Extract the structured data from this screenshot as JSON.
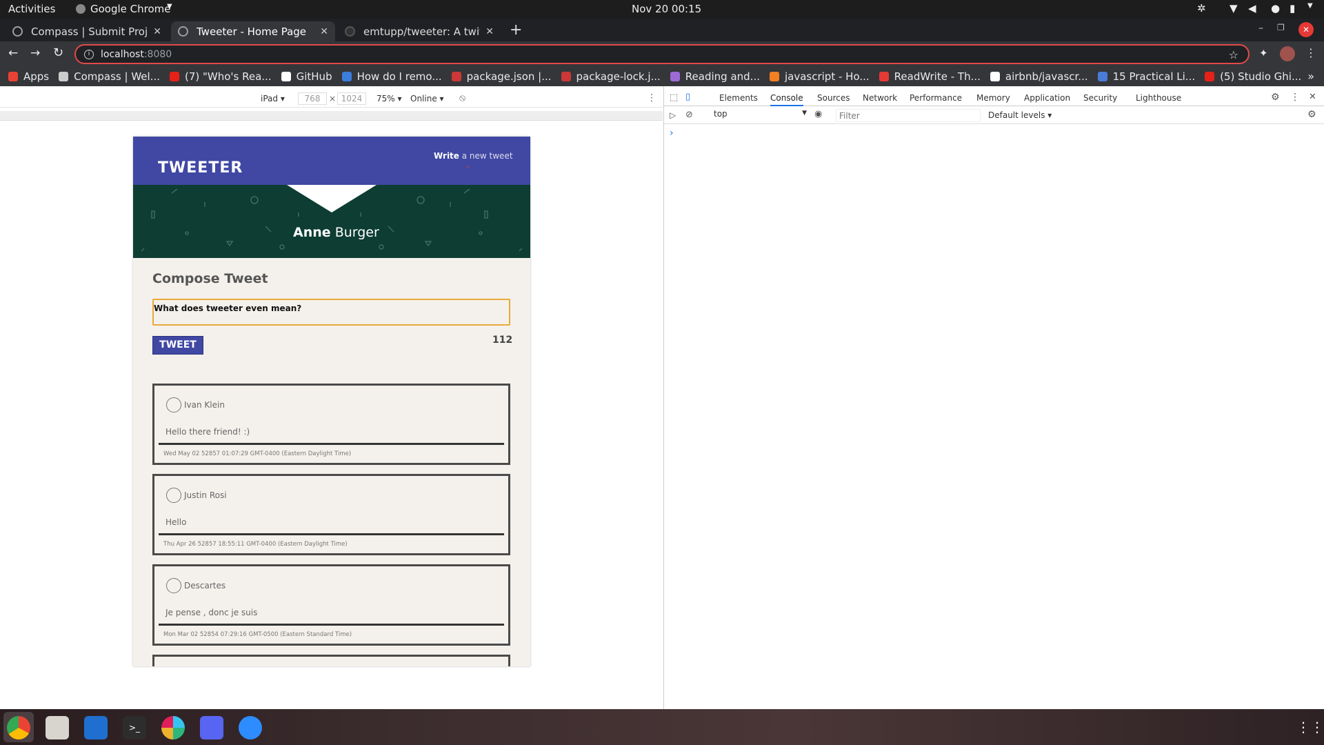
{
  "topbar": {
    "activities": "Activities",
    "app_name": "Google Chrome",
    "datetime": "Nov 20  00:15"
  },
  "tabs": [
    {
      "title": "Compass | Submit Project"
    },
    {
      "title": "Tweeter - Home Page"
    },
    {
      "title": "emtupp/tweeter: A twitter"
    }
  ],
  "omnibox": {
    "host": "localhost",
    "port": ":8080"
  },
  "bookmarks": [
    {
      "label": "Apps",
      "color": "#e94235"
    },
    {
      "label": "Compass | Wel...",
      "color": "#cccccc"
    },
    {
      "label": "(7) \"Who's Rea...",
      "color": "#e62117"
    },
    {
      "label": "GitHub",
      "color": "#ffffff"
    },
    {
      "label": "How do I remo...",
      "color": "#3b7ddd"
    },
    {
      "label": "package.json |...",
      "color": "#cb3837"
    },
    {
      "label": "package-lock.j...",
      "color": "#cb3837"
    },
    {
      "label": "Reading and...",
      "color": "#9d6bd6"
    },
    {
      "label": "javascript - Ho...",
      "color": "#f48024"
    },
    {
      "label": "ReadWrite - Th...",
      "color": "#e53935"
    },
    {
      "label": "airbnb/javascr...",
      "color": "#ffffff"
    },
    {
      "label": "15 Practical Li...",
      "color": "#4a7bd8"
    },
    {
      "label": "(5) Studio Ghi...",
      "color": "#e62117"
    }
  ],
  "device_toolbar": {
    "device": "iPad",
    "width": "768",
    "times": "×",
    "height": "1024",
    "zoom": "75%",
    "network": "Online"
  },
  "app": {
    "logo": "TWEETER",
    "write_bold": "Write",
    "write_rest": " a new tweet",
    "user_first": "Anne",
    "user_last": " Burger",
    "compose_title": "Compose Tweet",
    "compose_value": "What does tweeter even mean?",
    "tweet_button": "TWEET",
    "counter": "112",
    "tweets": [
      {
        "name": "Ivan Klein",
        "content": "Hello there friend! :)",
        "date": "Wed May 02 52857 01:07:29 GMT-0400 (Eastern Daylight Time)"
      },
      {
        "name": "Justin Rosi",
        "content": "Hello",
        "date": "Thu Apr 26 52857 18:55:11 GMT-0400 (Eastern Daylight Time)"
      },
      {
        "name": "Descartes",
        "content": "Je pense , donc je suis",
        "date": "Mon Mar 02 52854 07:29:16 GMT-0500 (Eastern Standard Time)"
      }
    ]
  },
  "devtools": {
    "tabs": [
      "Elements",
      "Console",
      "Sources",
      "Network",
      "Performance",
      "Memory",
      "Application",
      "Security",
      "Lighthouse"
    ],
    "active_tab": "Console",
    "context": "top",
    "filter_placeholder": "Filter",
    "levels": "Default levels",
    "prompt": "›"
  },
  "colors": {
    "header": "#4048a3",
    "banner": "#0d3d33",
    "compose_border": "#e8a93a",
    "close_red": "#e53935"
  }
}
